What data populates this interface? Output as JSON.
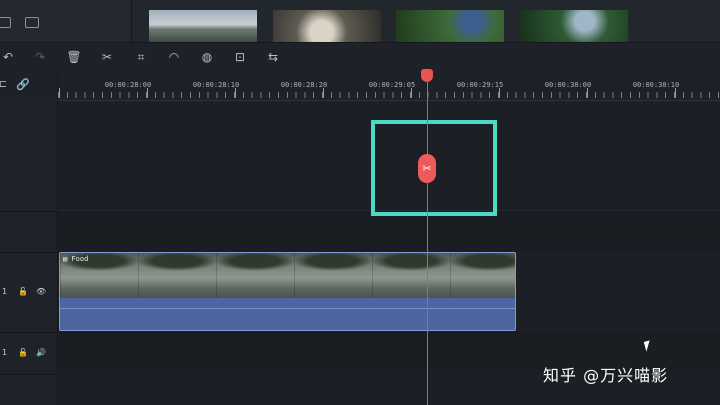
{
  "media_bin": {
    "icons": [
      "import-media-icon",
      "new-folder-icon"
    ],
    "thumbnails": [
      "lake-thumbnail",
      "food-bowl-thumbnail",
      "cyclist-thumbnail",
      "hiker-thumbnail"
    ]
  },
  "toolbar": {
    "icons": [
      "undo-icon",
      "redo-icon",
      "delete-icon",
      "split-icon",
      "crop-icon",
      "speed-icon",
      "color-icon",
      "green-screen-icon",
      "audio-adjust-icon"
    ]
  },
  "ruler": {
    "ticks": [
      "00:00:28:00",
      "00:00:28:10",
      "00:00:28:20",
      "00:00:29:05",
      "00:00:29:15",
      "00:00:30:00",
      "00:00:30:10"
    ]
  },
  "tracks": {
    "video_track_number": "1",
    "audio_track_number": "1"
  },
  "clip": {
    "label": "Food"
  },
  "watermark": "知乎 @万兴喵影",
  "colors": {
    "playhead": "#e55050",
    "highlight_box": "#4fd8c4",
    "clip": "#4f6aa8"
  }
}
